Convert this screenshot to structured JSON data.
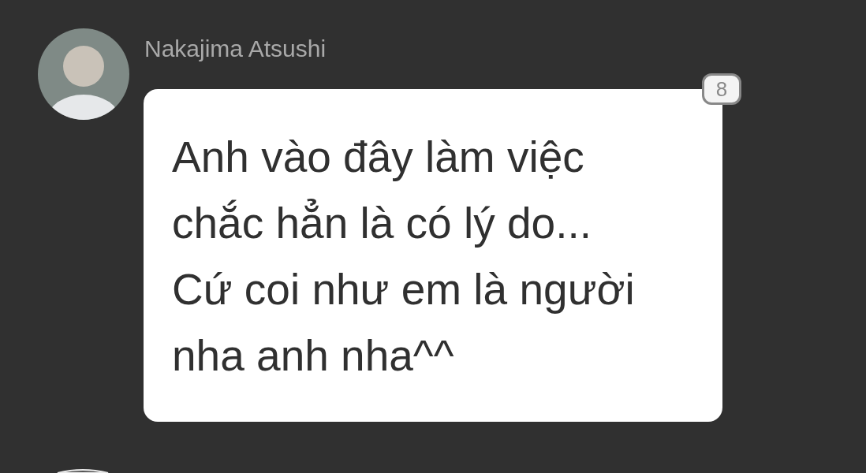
{
  "messages": [
    {
      "sender": "Nakajima Atsushi",
      "badge": "8",
      "lines": [
        "Anh vào đây làm việc",
        "chắc hẳn là có lý do...",
        "Cứ coi như em là người",
        "nha anh nha^^"
      ]
    }
  ]
}
